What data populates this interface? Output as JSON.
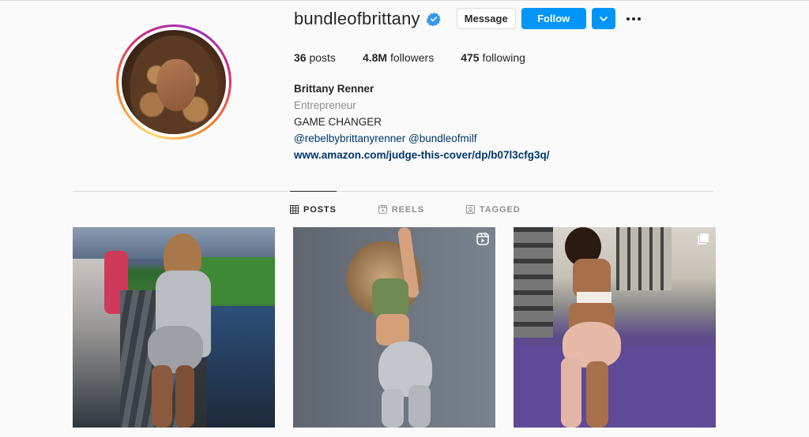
{
  "profile": {
    "username": "bundleofbrittany",
    "verified": true,
    "buttons": {
      "message": "Message",
      "follow": "Follow"
    },
    "stats": {
      "posts_count": "36",
      "posts_label": "posts",
      "followers_count": "4.8M",
      "followers_label": "followers",
      "following_count": "475",
      "following_label": "following"
    },
    "bio": {
      "name": "Brittany Renner",
      "category": "Entrepreneur",
      "line1": "GAME CHANGER",
      "tags": "@rebelbybrittanyrenner @bundleofmilf",
      "link": "www.amazon.com/judge-this-cover/dp/b07l3cfg3q/"
    }
  },
  "tabs": [
    {
      "label": "POSTS",
      "icon": "grid-icon",
      "active": true
    },
    {
      "label": "REELS",
      "icon": "reels-icon",
      "active": false
    },
    {
      "label": "TAGGED",
      "icon": "tagged-icon",
      "active": false
    }
  ],
  "posts": [
    {
      "type": "photo",
      "icon": null
    },
    {
      "type": "reel",
      "icon": "reel-icon"
    },
    {
      "type": "carousel",
      "icon": "carousel-icon"
    }
  ],
  "colors": {
    "accent": "#0095f6",
    "verified": "#3897f0",
    "link": "#00376b",
    "muted": "#8e8e8e",
    "text": "#262626",
    "border": "#dbdbdb",
    "background": "#fafafa"
  }
}
